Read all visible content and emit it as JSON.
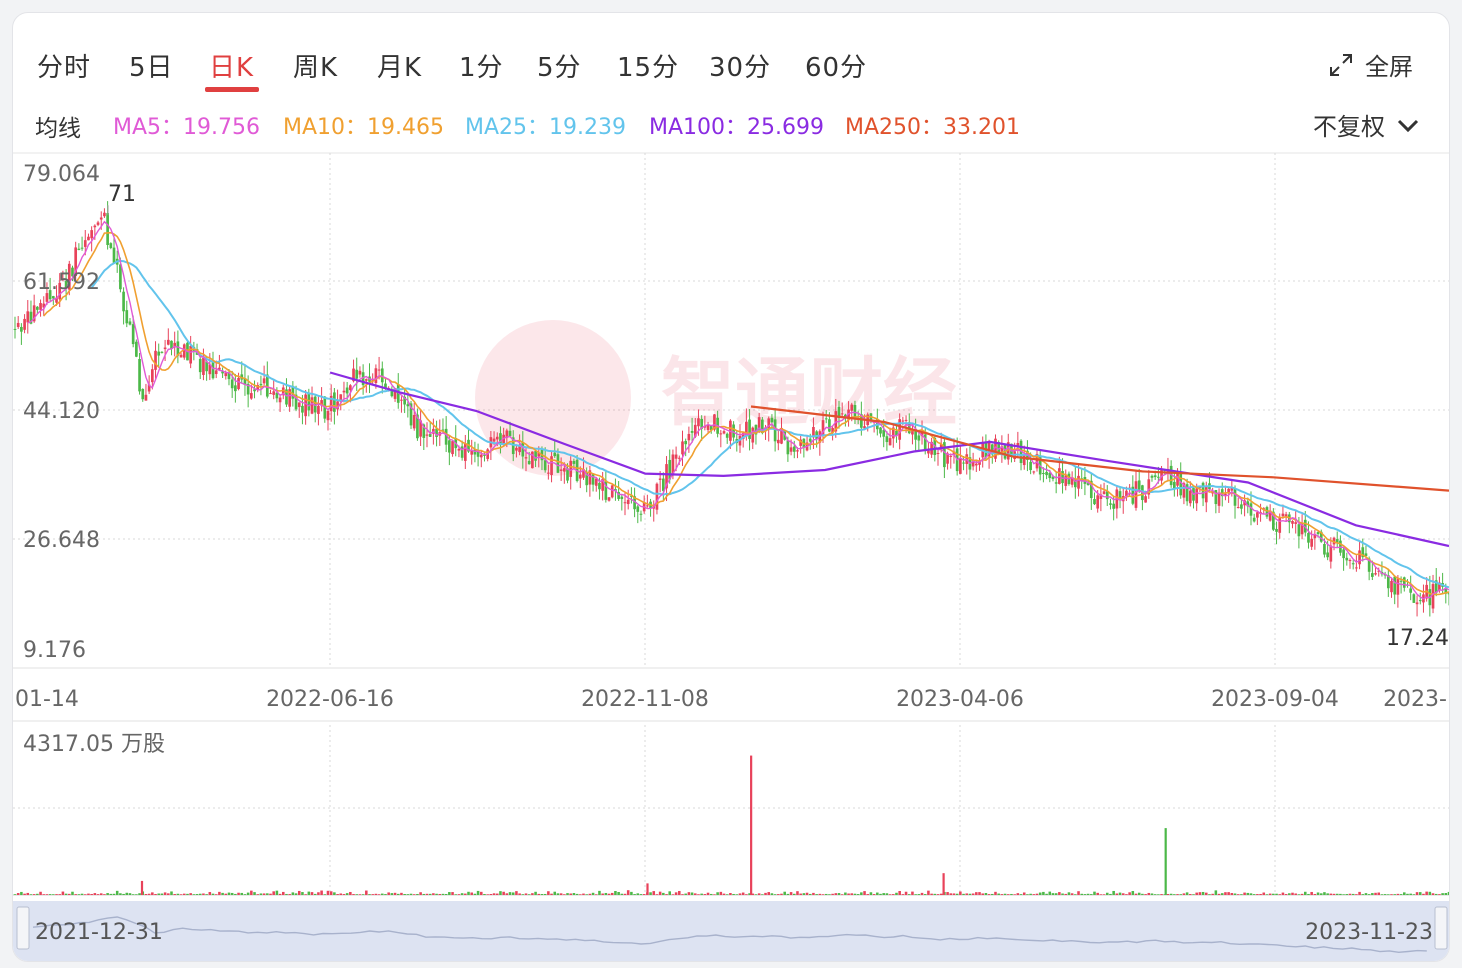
{
  "tabs": [
    {
      "label": "分时",
      "active": false
    },
    {
      "label": "5日",
      "active": false
    },
    {
      "label": "日K",
      "active": true
    },
    {
      "label": "周K",
      "active": false
    },
    {
      "label": "月K",
      "active": false
    },
    {
      "label": "1分",
      "active": false
    },
    {
      "label": "5分",
      "active": false
    },
    {
      "label": "15分",
      "active": false
    },
    {
      "label": "30分",
      "active": false
    },
    {
      "label": "60分",
      "active": false
    }
  ],
  "fullscreen": {
    "label": "全屏",
    "icon": "expand-arrows-icon"
  },
  "ma_bar": {
    "label": "均线",
    "items": [
      {
        "text": "MA5：19.756",
        "color": "#e05ad6"
      },
      {
        "text": "MA10：19.465",
        "color": "#f0a030"
      },
      {
        "text": "MA25：19.239",
        "color": "#62c4ec"
      },
      {
        "text": "MA100：25.699",
        "color": "#8a2be2"
      },
      {
        "text": "MA250：33.201",
        "color": "#e0522c"
      }
    ],
    "adjust": {
      "label": "不复权",
      "icon": "chevron-down-icon"
    }
  },
  "watermark": "智通财经",
  "colors": {
    "up": "#e8425a",
    "down": "#4cb848",
    "grid": "#d8d8d8"
  },
  "chart_data": {
    "type": "candlestick",
    "y_ticks": [
      "79.064",
      "61.592",
      "44.120",
      "26.648",
      "9.176"
    ],
    "y_range": [
      9.176,
      79.064
    ],
    "x_ticks": [
      "01-14",
      "2022-06-16",
      "2022-11-08",
      "2023-04-06",
      "2023-09-04",
      "2023-"
    ],
    "high_label": "71",
    "low_label": "17.24",
    "price_path": [
      [
        "2022-01-14",
        55
      ],
      [
        "2022-01-24",
        57
      ],
      [
        "2022-02-07",
        62
      ],
      [
        "2022-02-18",
        68
      ],
      [
        "2022-02-25",
        70
      ],
      [
        "2022-03-07",
        58
      ],
      [
        "2022-03-15",
        46
      ],
      [
        "2022-03-22",
        52
      ],
      [
        "2022-04-01",
        53
      ],
      [
        "2022-04-15",
        50
      ],
      [
        "2022-04-29",
        48
      ],
      [
        "2022-05-13",
        47
      ],
      [
        "2022-05-27",
        45
      ],
      [
        "2022-06-10",
        44
      ],
      [
        "2022-06-24",
        49
      ],
      [
        "2022-07-08",
        48
      ],
      [
        "2022-07-22",
        42
      ],
      [
        "2022-08-05",
        40
      ],
      [
        "2022-08-19",
        38
      ],
      [
        "2022-09-02",
        40
      ],
      [
        "2022-09-16",
        38
      ],
      [
        "2022-09-30",
        36
      ],
      [
        "2022-10-14",
        35
      ],
      [
        "2022-10-28",
        31
      ],
      [
        "2022-11-08",
        31
      ],
      [
        "2022-11-22",
        37
      ],
      [
        "2022-12-06",
        43
      ],
      [
        "2022-12-20",
        41
      ],
      [
        "2023-01-03",
        42
      ],
      [
        "2023-01-17",
        39
      ],
      [
        "2023-01-31",
        42
      ],
      [
        "2023-02-14",
        44
      ],
      [
        "2023-02-28",
        41
      ],
      [
        "2023-03-14",
        42
      ],
      [
        "2023-03-28",
        38
      ],
      [
        "2023-04-06",
        37
      ],
      [
        "2023-04-20",
        39
      ],
      [
        "2023-05-04",
        38
      ],
      [
        "2023-05-18",
        36
      ],
      [
        "2023-06-01",
        34
      ],
      [
        "2023-06-15",
        32
      ],
      [
        "2023-06-29",
        33
      ],
      [
        "2023-07-13",
        35
      ],
      [
        "2023-07-27",
        32
      ],
      [
        "2023-08-10",
        33
      ],
      [
        "2023-08-24",
        30
      ],
      [
        "2023-09-04",
        29
      ],
      [
        "2023-09-18",
        27
      ],
      [
        "2023-10-02",
        25
      ],
      [
        "2023-10-16",
        23
      ],
      [
        "2023-10-30",
        20
      ],
      [
        "2023-11-13",
        19
      ],
      [
        "2023-11-23",
        20
      ]
    ],
    "ma100": [
      [
        "2022-06-12",
        49.2
      ],
      [
        "2022-07-15",
        46.5
      ],
      [
        "2022-08-20",
        44.0
      ],
      [
        "2022-10-01",
        39.5
      ],
      [
        "2022-11-08",
        35.5
      ],
      [
        "2022-12-15",
        35.2
      ],
      [
        "2023-02-01",
        36.0
      ],
      [
        "2023-03-15",
        38.5
      ],
      [
        "2023-04-20",
        39.8
      ],
      [
        "2023-06-15",
        37.2
      ],
      [
        "2023-08-20",
        34.3
      ],
      [
        "2023-10-10",
        28.5
      ],
      [
        "2023-11-23",
        25.7
      ]
    ],
    "ma250": [
      [
        "2022-12-28",
        44.6
      ],
      [
        "2023-03-01",
        42.5
      ],
      [
        "2023-05-01",
        37.8
      ],
      [
        "2023-07-01",
        35.8
      ],
      [
        "2023-09-01",
        35.0
      ],
      [
        "2023-11-23",
        33.2
      ]
    ],
    "volume": {
      "label": "4317.05 万股",
      "max": 4317.05,
      "spikes": [
        [
          "2022-12-28",
          3960
        ],
        [
          "2023-07-12",
          1900
        ],
        [
          "2022-03-15",
          400
        ],
        [
          "2022-11-09",
          330
        ],
        [
          "2023-03-29",
          620
        ]
      ]
    },
    "navigator": {
      "start": "2021-12-31",
      "end": "2023-11-23"
    }
  }
}
